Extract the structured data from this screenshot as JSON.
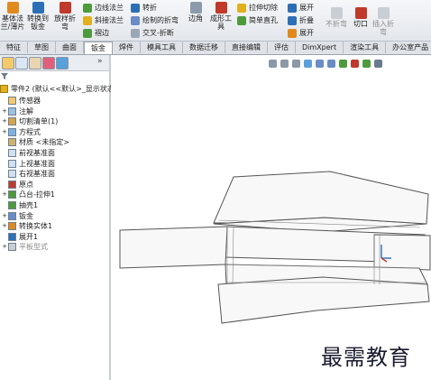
{
  "ribbon": {
    "big_buttons": [
      {
        "label": "基体法\n兰/薄片",
        "icon": "base-flange-icon"
      },
      {
        "label": "转换到\n钣金",
        "icon": "convert-to-sheetmetal-icon"
      },
      {
        "label": "放样折\n弯",
        "icon": "lofted-bend-icon"
      }
    ],
    "small_buttons": [
      {
        "label": "边线法兰",
        "icon": "edge-flange-icon"
      },
      {
        "label": "斜接法兰",
        "icon": "miter-flange-icon"
      },
      {
        "label": "褶边",
        "icon": "hem-icon"
      },
      {
        "label": "转折",
        "icon": "jog-icon"
      },
      {
        "label": "绘制的折弯",
        "icon": "sketched-bend-icon"
      },
      {
        "label": "交叉-折断",
        "icon": "cross-break-icon"
      },
      {
        "label": "拉伸切除",
        "icon": "extruded-cut-icon"
      },
      {
        "label": "简单直孔",
        "icon": "simple-hole-icon"
      },
      {
        "label": "展开",
        "icon": "unfold-icon"
      },
      {
        "label": "折叠",
        "icon": "fold-icon"
      },
      {
        "label": "展开",
        "icon": "flatten-icon"
      }
    ],
    "mid_buttons": [
      {
        "label": "边角",
        "icon": "corner-icon"
      },
      {
        "label": "成形工\n具",
        "icon": "forming-tool-icon"
      },
      {
        "label": "不折弯",
        "icon": "no-bends-icon"
      },
      {
        "label": "切口",
        "icon": "rip-icon"
      },
      {
        "label": "插入折\n弯",
        "icon": "insert-bends-icon"
      }
    ]
  },
  "tabs": [
    "特征",
    "草图",
    "曲面",
    "钣金",
    "焊件",
    "模具工具",
    "数据迁移",
    "直接编辑",
    "评估",
    "DimXpert",
    "渲染工具",
    "办公室产品"
  ],
  "active_tab": "钣金",
  "tree": {
    "root": "零件2 (默认<<默认>_显示状态",
    "items": [
      {
        "label": "传感器",
        "icon": "sensor-folder-icon",
        "expander": "",
        "dim": false
      },
      {
        "label": "注解",
        "icon": "annotations-icon",
        "expander": "+",
        "dim": false
      },
      {
        "label": "切割清单(1)",
        "icon": "cut-list-icon",
        "expander": "+",
        "dim": false
      },
      {
        "label": "方程式",
        "icon": "equations-icon",
        "expander": "+",
        "dim": false
      },
      {
        "label": "材质 <未指定>",
        "icon": "material-icon",
        "expander": "",
        "dim": false
      },
      {
        "label": "前视基准面",
        "icon": "plane-icon",
        "expander": "",
        "dim": false
      },
      {
        "label": "上视基准面",
        "icon": "plane-icon",
        "expander": "",
        "dim": false
      },
      {
        "label": "右视基准面",
        "icon": "plane-icon",
        "expander": "",
        "dim": false
      },
      {
        "label": "原点",
        "icon": "origin-icon",
        "expander": "",
        "dim": false
      },
      {
        "label": "凸台-拉伸1",
        "icon": "boss-extrude-icon",
        "expander": "+",
        "dim": false
      },
      {
        "label": "抽壳1",
        "icon": "shell-icon",
        "expander": "",
        "dim": false
      },
      {
        "label": "钣金",
        "icon": "sheetmetal-icon",
        "expander": "+",
        "dim": false
      },
      {
        "label": "转换实体1",
        "icon": "convert-solid-icon",
        "expander": "+",
        "dim": false
      },
      {
        "label": "展开1",
        "icon": "unfold-feature-icon",
        "expander": "",
        "dim": false
      },
      {
        "label": "平板型式",
        "icon": "flat-pattern-icon",
        "expander": "+",
        "dim": true
      }
    ]
  },
  "panel_toolbar": [
    "feature-manager-icon",
    "property-manager-icon",
    "configuration-manager-icon",
    "dimxpert-manager-icon",
    "display-manager-icon"
  ],
  "panel_toolbar_more": "»",
  "view_tools": [
    "zoom-fit-icon",
    "zoom-area-icon",
    "previous-view-icon",
    "section-view-icon",
    "view-orientation-icon",
    "display-style-icon",
    "hide-show-icon",
    "appearance-icon",
    "scene-icon",
    "view-settings-icon"
  ],
  "watermark": "最需教育",
  "colors": {
    "accent_green": "#4e9a3c",
    "accent_blue": "#2d6fb5",
    "accent_orange": "#e08a1e",
    "part_face": "#f7f8f7",
    "part_edge": "#555555"
  }
}
